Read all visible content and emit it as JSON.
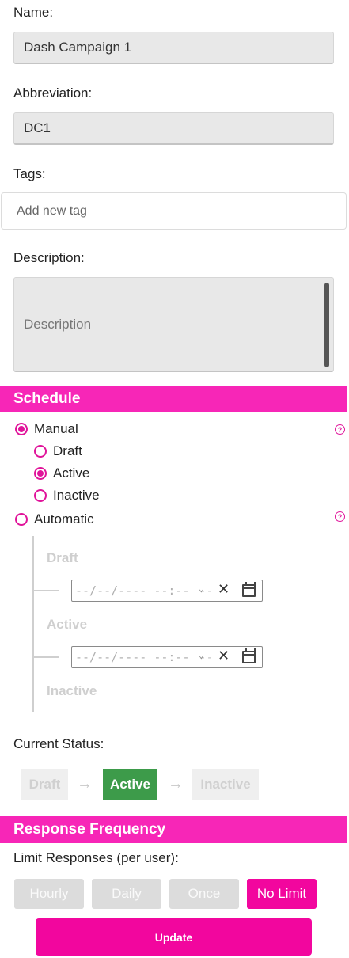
{
  "form": {
    "name_label": "Name:",
    "name_value": "Dash Campaign 1",
    "abbreviation_label": "Abbreviation:",
    "abbreviation_value": "DC1",
    "tags_label": "Tags:",
    "tags_placeholder": "Add new tag",
    "description_label": "Description:",
    "description_placeholder": "Description"
  },
  "schedule": {
    "title": "Schedule",
    "manual_label": "Manual",
    "manual_selected": true,
    "manual_options": [
      {
        "label": "Draft",
        "selected": false
      },
      {
        "label": "Active",
        "selected": true
      },
      {
        "label": "Inactive",
        "selected": false
      }
    ],
    "automatic_label": "Automatic",
    "automatic_selected": false,
    "help_icon": "?",
    "timeline": {
      "draft_label": "Draft",
      "active_label": "Active",
      "inactive_label": "Inactive",
      "datetime_placeholder": "--/--/---- --:--",
      "ampm_placeholder": "--"
    },
    "current_status_label": "Current Status:",
    "status_steps": [
      "Draft",
      "Active",
      "Inactive"
    ],
    "current_status": "Active",
    "arrow_glyph": "→"
  },
  "response_frequency": {
    "title": "Response Frequency",
    "limit_label": "Limit Responses (per user):",
    "options": [
      "Hourly",
      "Daily",
      "Once",
      "No Limit"
    ],
    "selected": "No Limit"
  },
  "update_label": "Update",
  "colors": {
    "accent": "#f726b7",
    "button_pink": "#f2069e",
    "active_green": "#3d9b4a"
  }
}
